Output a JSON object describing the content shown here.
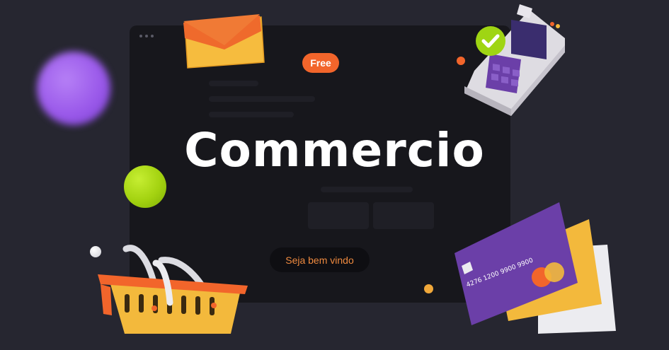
{
  "badge": {
    "label": "Free"
  },
  "hero": {
    "title": "Commercio"
  },
  "cta": {
    "label": "Seja bem vindo"
  },
  "card": {
    "number": "4276 1200 9900 9900"
  },
  "colors": {
    "background": "#262630",
    "window": "#17171c",
    "accent_orange": "#f2652b",
    "card_purple": "#6b3fa8",
    "card_yellow": "#f3b93c",
    "green": "#a3d210",
    "purple_blob": "#9a59ea"
  },
  "icons": [
    "envelope-icon",
    "payment-terminal-icon",
    "checkmark-icon",
    "credit-card-icon",
    "shopping-basket-icon"
  ]
}
